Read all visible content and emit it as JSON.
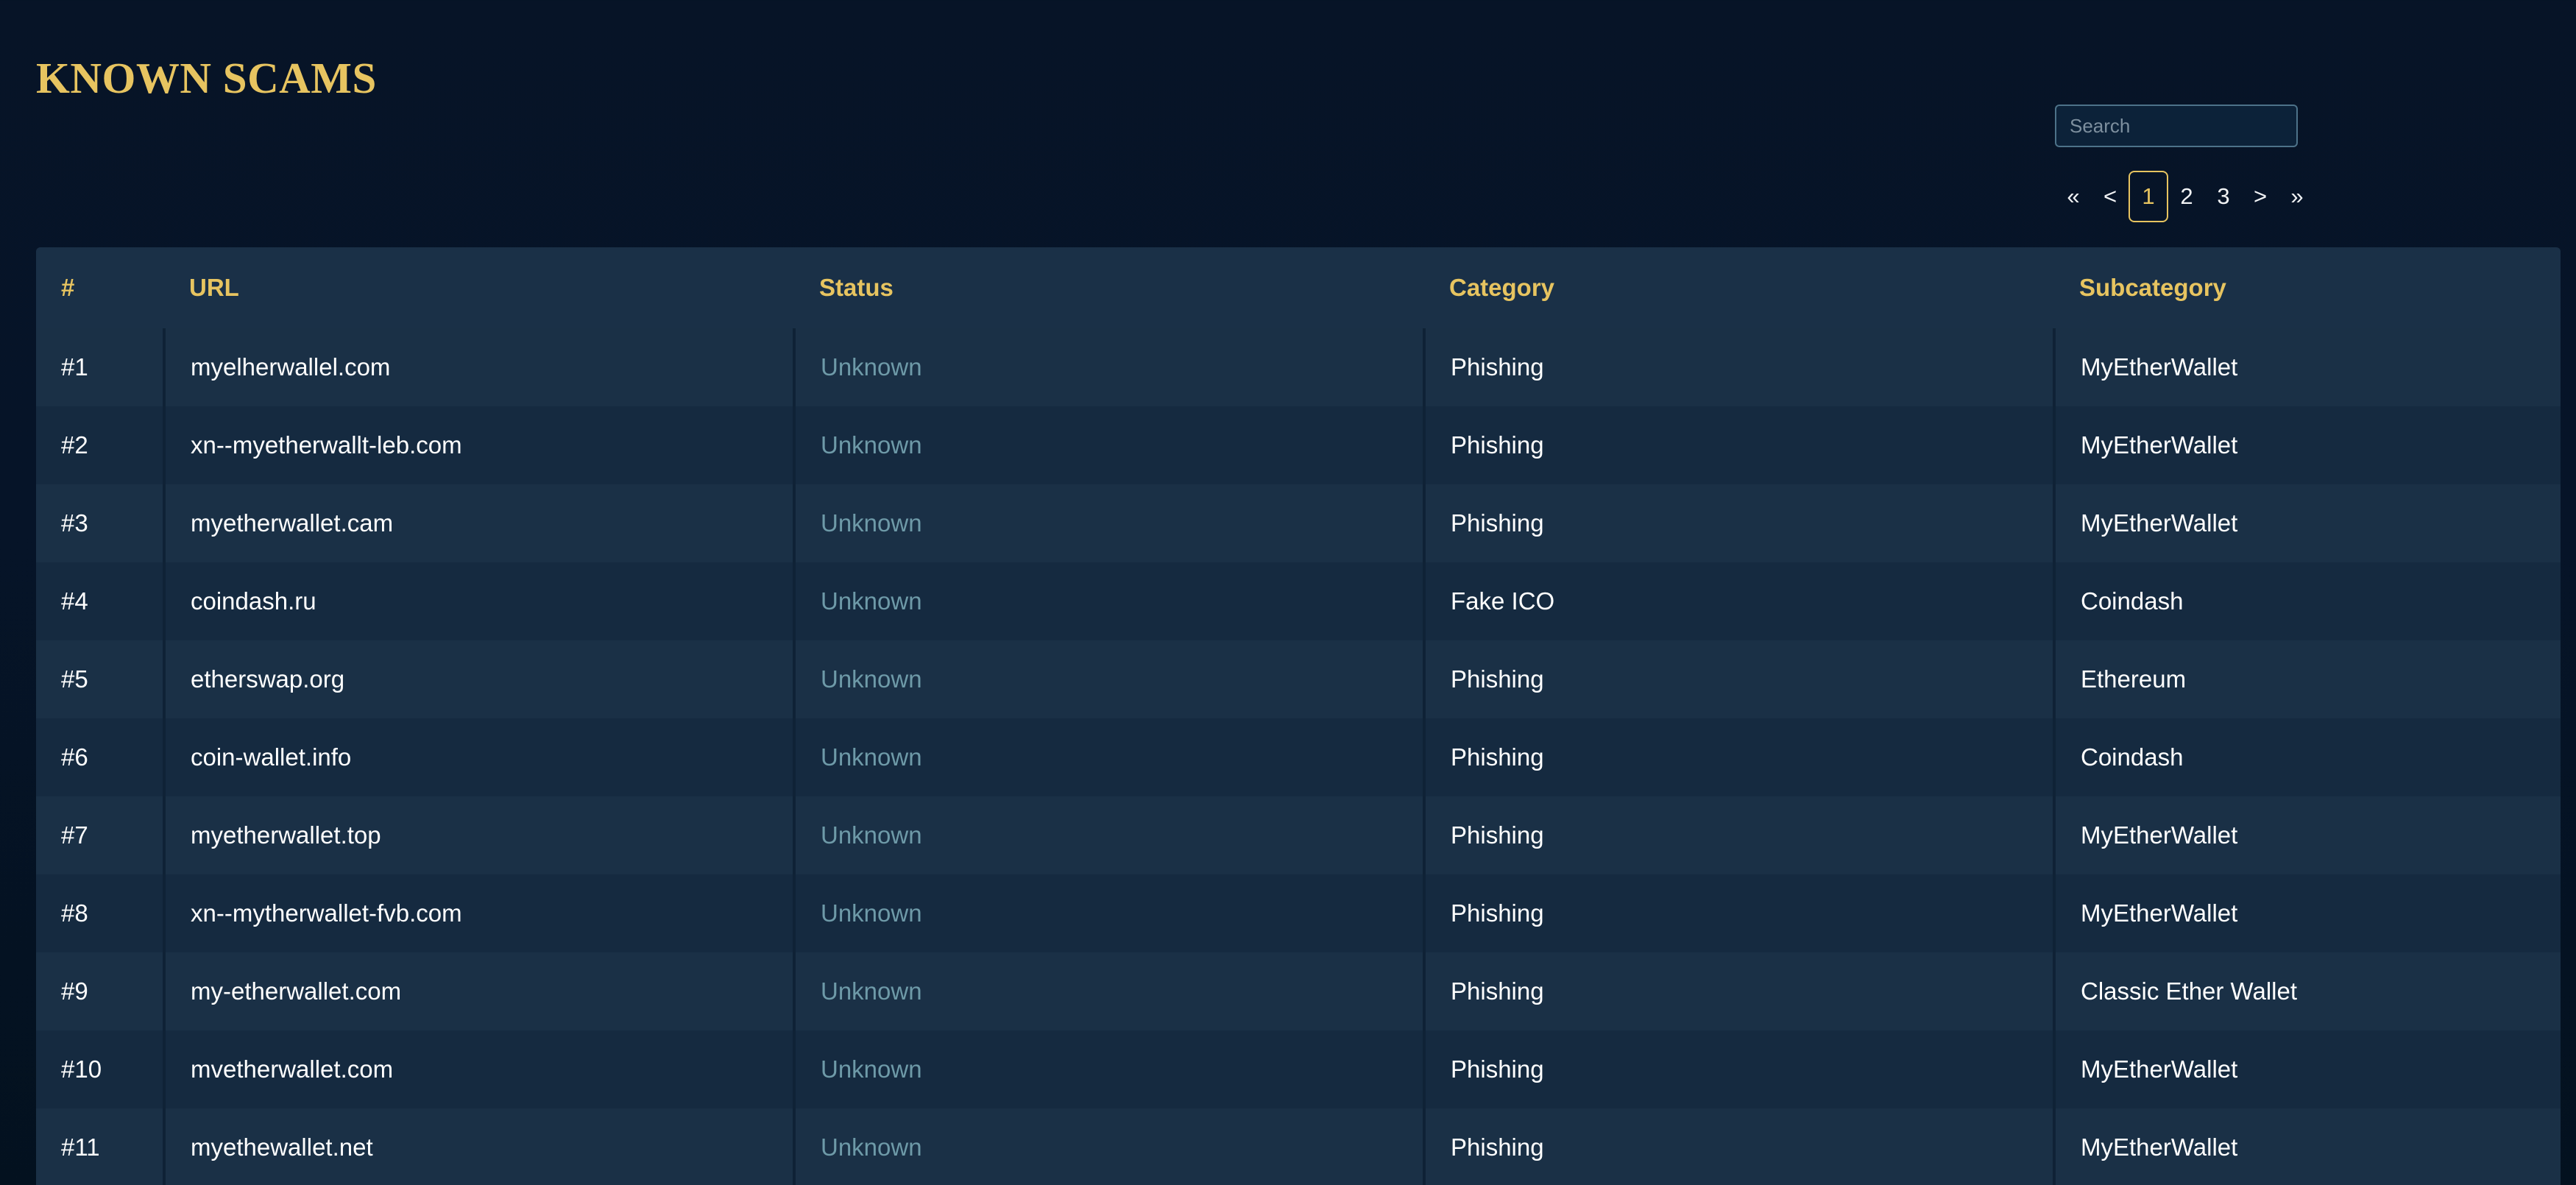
{
  "page": {
    "title": "KNOWN SCAMS"
  },
  "search": {
    "placeholder": "Search",
    "value": ""
  },
  "pagination": {
    "first": "«",
    "prev": "<",
    "pages": [
      "1",
      "2",
      "3"
    ],
    "current": "1",
    "next": ">",
    "last": "»"
  },
  "table": {
    "columns": [
      "#",
      "URL",
      "Status",
      "Category",
      "Subcategory"
    ],
    "rows": [
      {
        "id": "#1",
        "url": "myelherwallel.com",
        "status": "Unknown",
        "category": "Phishing",
        "subcategory": "MyEtherWallet"
      },
      {
        "id": "#2",
        "url": "xn--myetherwallt-leb.com",
        "status": "Unknown",
        "category": "Phishing",
        "subcategory": "MyEtherWallet"
      },
      {
        "id": "#3",
        "url": "myetherwallet.cam",
        "status": "Unknown",
        "category": "Phishing",
        "subcategory": "MyEtherWallet"
      },
      {
        "id": "#4",
        "url": "coindash.ru",
        "status": "Unknown",
        "category": "Fake ICO",
        "subcategory": "Coindash"
      },
      {
        "id": "#5",
        "url": "etherswap.org",
        "status": "Unknown",
        "category": "Phishing",
        "subcategory": "Ethereum"
      },
      {
        "id": "#6",
        "url": "coin-wallet.info",
        "status": "Unknown",
        "category": "Phishing",
        "subcategory": "Coindash"
      },
      {
        "id": "#7",
        "url": "myetherwallet.top",
        "status": "Unknown",
        "category": "Phishing",
        "subcategory": "MyEtherWallet"
      },
      {
        "id": "#8",
        "url": "xn--mytherwallet-fvb.com",
        "status": "Unknown",
        "category": "Phishing",
        "subcategory": "MyEtherWallet"
      },
      {
        "id": "#9",
        "url": "my-etherwallet.com",
        "status": "Unknown",
        "category": "Phishing",
        "subcategory": "Classic Ether Wallet"
      },
      {
        "id": "#10",
        "url": "mvetherwallet.com",
        "status": "Unknown",
        "category": "Phishing",
        "subcategory": "MyEtherWallet"
      },
      {
        "id": "#11",
        "url": "myethewallet.net",
        "status": "Unknown",
        "category": "Phishing",
        "subcategory": "MyEtherWallet"
      }
    ]
  },
  "colors": {
    "background": "#061428",
    "accent": "#e7c460",
    "table_bg": "#1a3047",
    "status_text": "#6e9aa8"
  }
}
